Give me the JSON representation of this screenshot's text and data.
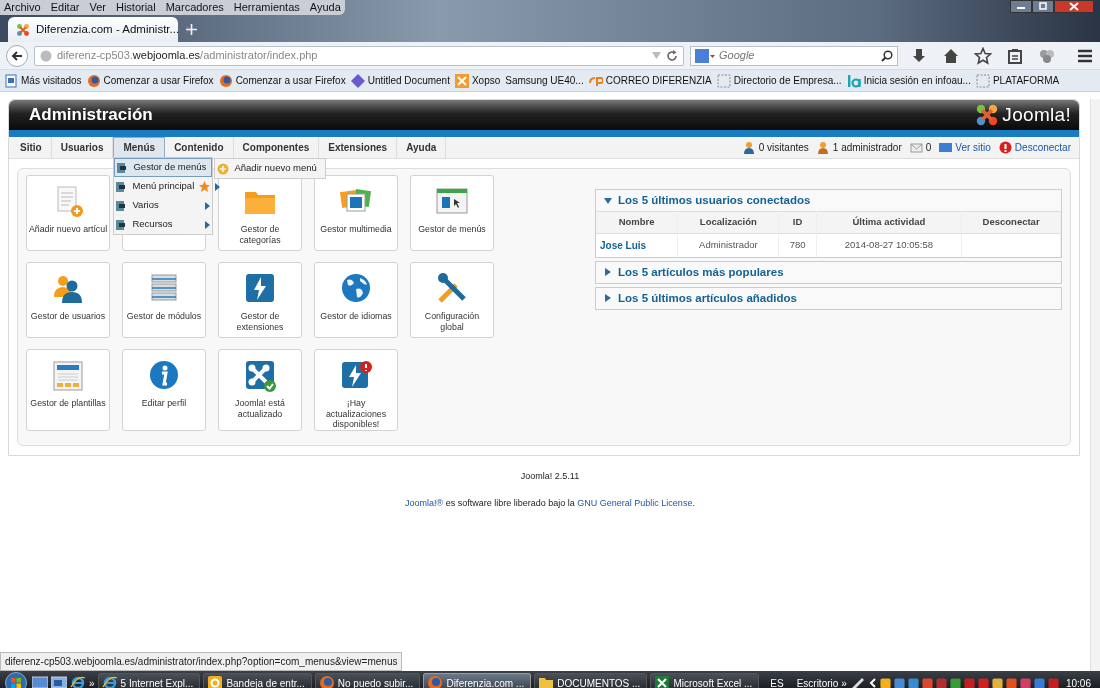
{
  "browser": {
    "menu": [
      "Archivo",
      "Editar",
      "Ver",
      "Historial",
      "Marcadores",
      "Herramientas",
      "Ayuda"
    ],
    "tabs": [
      {
        "title": "Diferenzia.com - Administr...",
        "selected": true
      }
    ],
    "address": {
      "host_prefix": "diferenz-cp503.",
      "domain": "webjoomla.es",
      "path": "/administrator/index.php"
    },
    "search": {
      "placeholder": "Google"
    },
    "bookmarks": [
      {
        "label": "Más visitados"
      },
      {
        "label": "Comenzar a usar Firefox"
      },
      {
        "label": "Comenzar a usar Firefox"
      },
      {
        "label": "Untitled Document"
      },
      {
        "label": "Xopso"
      },
      {
        "label": "Samsung UE40..."
      },
      {
        "label": "CORREO DIFERENZIA"
      },
      {
        "label": "Directorio de Empresa..."
      },
      {
        "label": "Inicia sesión en infoau..."
      },
      {
        "label": "PLATAFORMA"
      }
    ]
  },
  "admin": {
    "title": "Administración",
    "logo": "Joomla!",
    "menu": [
      {
        "label": "Sitio",
        "selected": false
      },
      {
        "label": "Usuarios",
        "selected": false
      },
      {
        "label": "Menús",
        "selected": true
      },
      {
        "label": "Contenido",
        "selected": false
      },
      {
        "label": "Componentes",
        "selected": false
      },
      {
        "label": "Extensiones",
        "selected": false
      },
      {
        "label": "Ayuda",
        "selected": false
      }
    ],
    "status": [
      {
        "text": "0 visitantes",
        "link": false
      },
      {
        "text": "1 administrador",
        "link": false
      },
      {
        "text": "0",
        "link": false
      },
      {
        "text": "Ver sitio",
        "link": true
      },
      {
        "text": "Desconectar",
        "link": true
      }
    ],
    "dropdown": [
      {
        "label": "Gestor de menús",
        "selected": true,
        "star": false,
        "submenu": false
      },
      {
        "label": "Menú principal",
        "selected": false,
        "star": true,
        "submenu": true
      },
      {
        "label": "Varios",
        "selected": false,
        "star": false,
        "submenu": true
      },
      {
        "label": "Recursos",
        "selected": false,
        "star": false,
        "submenu": true
      }
    ],
    "submenu": [
      {
        "label": "Añadir nuevo menú"
      }
    ],
    "tiles": [
      {
        "kind": "shortcut",
        "label": "Añadir nuevo artícul"
      },
      {
        "kind": "covered"
      },
      {
        "kind": "shortcut",
        "label": "Gestor de categorías"
      },
      {
        "kind": "shortcut",
        "label": "Gestor multimedia"
      },
      {
        "kind": "shortcut",
        "label": "Gestor de menús"
      },
      {
        "kind": "shortcut",
        "label": "Gestor de usuarios"
      },
      {
        "kind": "shortcut",
        "label": "Gestor de módulos"
      },
      {
        "kind": "shortcut",
        "label": "Gestor de extensiones"
      },
      {
        "kind": "shortcut",
        "label": "Gestor de idiomas"
      },
      {
        "kind": "shortcut",
        "label": "Configuración global"
      },
      {
        "kind": "shortcut",
        "label": "Gestor de plantillas"
      },
      {
        "kind": "shortcut",
        "label": "Editar perfil"
      },
      {
        "kind": "shortcut",
        "label": "Joomla! está actualizado"
      },
      {
        "kind": "shortcut",
        "label": "¡Hay actualizaciones disponibles!"
      }
    ],
    "panels": [
      {
        "title": "Los 5 últimos usuarios conectados",
        "expanded": true,
        "table": {
          "columns": [
            "Nombre",
            "Localización",
            "ID",
            "Última actividad",
            "Desconectar"
          ],
          "rows": [
            [
              "Jose Luis",
              "Administrador",
              "780",
              "2014-08-27 10:05:58"
            ]
          ]
        }
      },
      {
        "title": "Los 5 artículos más populares",
        "expanded": false
      },
      {
        "title": "Los 5 últimos artículos añadidos",
        "expanded": false
      }
    ],
    "footer": {
      "version": "Joomla! 2.5.11",
      "license": [
        {
          "text": "Joomla!®",
          "link": true
        },
        {
          "text": " es software libre liberado bajo la ",
          "link": false
        },
        {
          "text": "GNU General Public License",
          "link": true
        },
        {
          "text": ".",
          "link": false
        }
      ]
    }
  },
  "status_url": "diferenz-cp503.webjoomla.es/administrator/index.php?option=com_menus&view=menus",
  "taskbar": {
    "tasks": [
      {
        "label": "5 Internet Expl...",
        "selected": false
      },
      {
        "label": "Bandeja de entr...",
        "selected": false
      },
      {
        "label": "No puedo subir...",
        "selected": false
      },
      {
        "label": "Diferenzia.com ...",
        "selected": true
      },
      {
        "label": "DOCUMENTOS ...",
        "selected": false
      },
      {
        "label": "Microsoft Excel ...",
        "selected": false
      }
    ],
    "language": "ES",
    "toolbar": "Escritorio",
    "more": "»",
    "clock": "10:06"
  }
}
